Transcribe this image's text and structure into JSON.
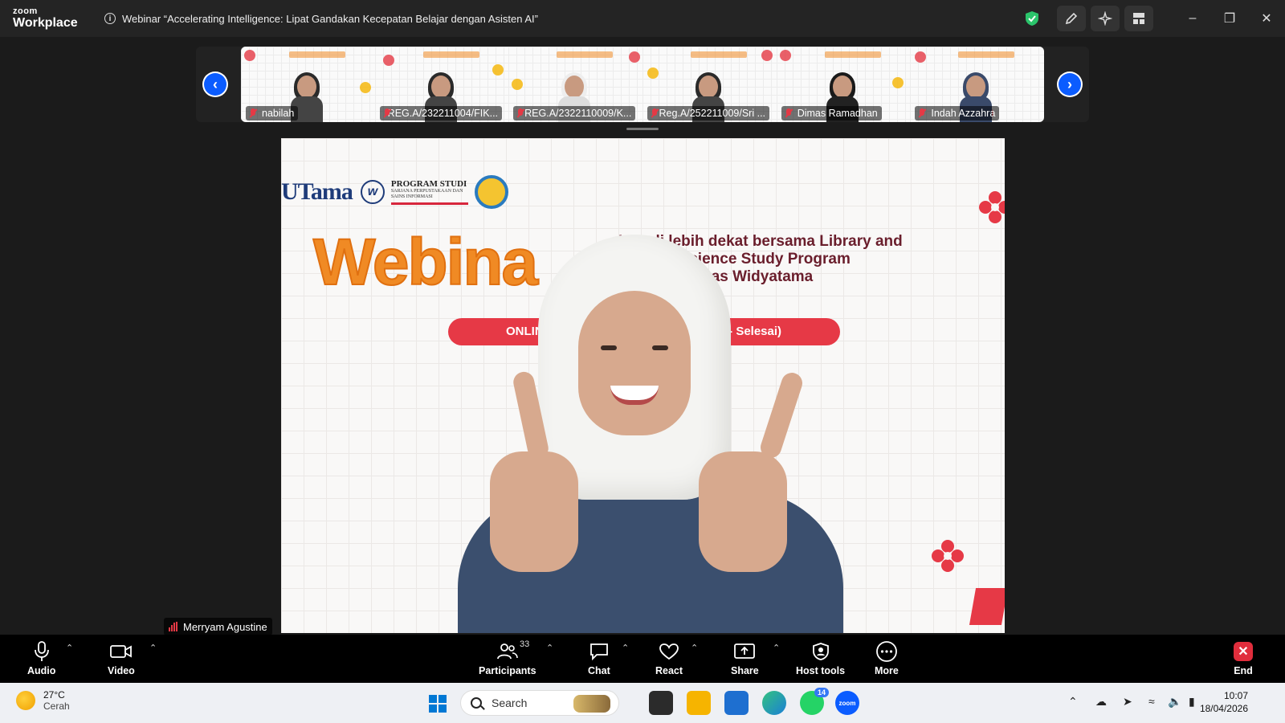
{
  "titlebar": {
    "logo_line1": "zoom",
    "logo_line2": "Workplace",
    "meeting_title": "Webinar “Accelerating Intelligence: Lipat Gandakan Kecepatan Belajar dengan Asisten AI”"
  },
  "gallery": {
    "participants": [
      {
        "name": "nabilah"
      },
      {
        "name": "REG.A/232211004/FIK..."
      },
      {
        "name": "REG.A/2322110009/K..."
      },
      {
        "name": "Reg.A/252211009/Sri ..."
      },
      {
        "name": "Dimas Ramadhan"
      },
      {
        "name": "Indah Azzahra"
      }
    ]
  },
  "main_video": {
    "slide_logo_text": "UTama",
    "slide_logo_w": "w",
    "slide_program_title": "PROGRAM STUDI",
    "slide_program_sub": "SARJANA PERPUSTAKAAN DAN SAINS INFORMASI",
    "slide_webinar": "Webina",
    "slide_tagline_1": "Kenali lebih dekat bersama Library and",
    "slide_tagline_2": "mation Science Study Program",
    "slide_tagline_3": "O) Universitas Widyatama",
    "slide_pill_left": "ONLIN",
    "slide_pill_right": "WIB- Selesai)",
    "speaker_name": "Merryam Agustine"
  },
  "toolbar": {
    "audio": "Audio",
    "video": "Video",
    "participants": "Participants",
    "participants_count": "33",
    "chat": "Chat",
    "react": "React",
    "share": "Share",
    "host_tools": "Host tools",
    "more": "More",
    "end": "End"
  },
  "taskbar": {
    "temperature": "27°C",
    "weather": "Cerah",
    "search_placeholder": "Search",
    "whatsapp_badge": "14",
    "zoom_app": "zoom",
    "time": "10:07",
    "date": "18/04/2026"
  },
  "colors": {
    "accent_blue": "#0b5cff",
    "end_red": "#e02d3c",
    "shield_green": "#2bc46b"
  }
}
